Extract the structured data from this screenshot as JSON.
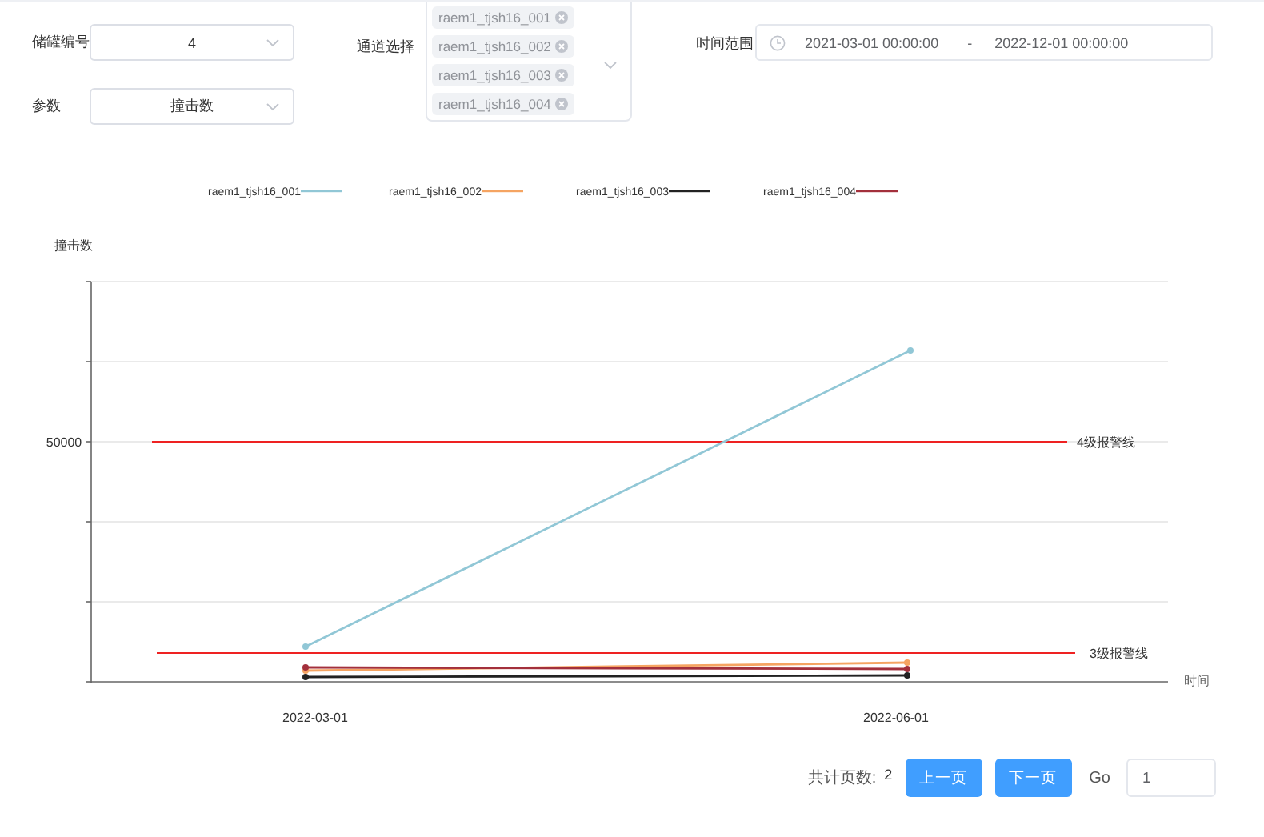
{
  "filters": {
    "tank": {
      "label": "储罐编号",
      "value": "4"
    },
    "param": {
      "label": "参数",
      "value": "撞击数"
    },
    "channels": {
      "label": "通道选择",
      "tags": [
        "raem1_tjsh16_001",
        "raem1_tjsh16_002",
        "raem1_tjsh16_003",
        "raem1_tjsh16_004"
      ]
    },
    "time_range": {
      "label": "时间范围",
      "start": "2021-03-01 00:00:00",
      "separator": "-",
      "end": "2022-12-01 00:00:00"
    }
  },
  "chart": {
    "legend": [
      {
        "name": "raem1_tjsh16_001",
        "color": "#91c7d6"
      },
      {
        "name": "raem1_tjsh16_002",
        "color": "#f5a462"
      },
      {
        "name": "raem1_tjsh16_003",
        "color": "#222222"
      },
      {
        "name": "raem1_tjsh16_004",
        "color": "#a3303c"
      }
    ],
    "y_axis_name": "撞击数",
    "y_tick_label": "50000",
    "x_labels": [
      "2022-03-01",
      "2022-06-01"
    ],
    "x_axis_name": "时间",
    "alarm_lines": [
      {
        "label": "4级报警线"
      },
      {
        "label": "3级报警线"
      }
    ]
  },
  "pagination": {
    "total_label": "共计页数:",
    "total": "2",
    "prev": "上一页",
    "next": "下一页",
    "go_label": "Go",
    "page": "1"
  }
}
